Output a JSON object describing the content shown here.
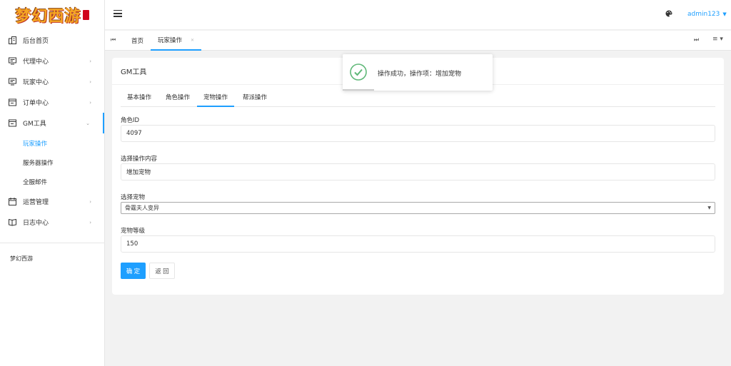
{
  "logo": {
    "text": "梦幻西游"
  },
  "sidebar": {
    "items": [
      {
        "label": "后台首页",
        "icon": "dashboard-icon"
      },
      {
        "label": "代理中心",
        "icon": "monitor-icon"
      },
      {
        "label": "玩家中心",
        "icon": "monitor-icon"
      },
      {
        "label": "订单中心",
        "icon": "window-icon"
      },
      {
        "label": "GM工具",
        "icon": "window-icon"
      },
      {
        "label": "运营管理",
        "icon": "calendar-icon"
      },
      {
        "label": "日志中心",
        "icon": "book-icon"
      }
    ],
    "gm_sub": [
      "玩家操作",
      "服务器操作",
      "全服邮件"
    ],
    "footer": "梦幻西游"
  },
  "header": {
    "user": "admin123"
  },
  "tabs": {
    "home": "首页",
    "current": "玩家操作"
  },
  "card": {
    "title": "GM工具",
    "subtabs": [
      "基本操作",
      "角色操作",
      "宠物操作",
      "帮派操作"
    ],
    "role_id_label": "角色ID",
    "role_id_value": "4097",
    "op_label": "选择操作内容",
    "op_value": "增加宠物",
    "pet_label": "选择宠物",
    "pet_value": "骨霆夫人变异",
    "level_label": "宠物等级",
    "level_value": "150",
    "confirm": "确 定",
    "back": "返 回"
  },
  "toast": {
    "message": "操作成功，操作项：增加宠物"
  },
  "colors": {
    "accent": "#1e9fff",
    "success": "#5fb878"
  }
}
